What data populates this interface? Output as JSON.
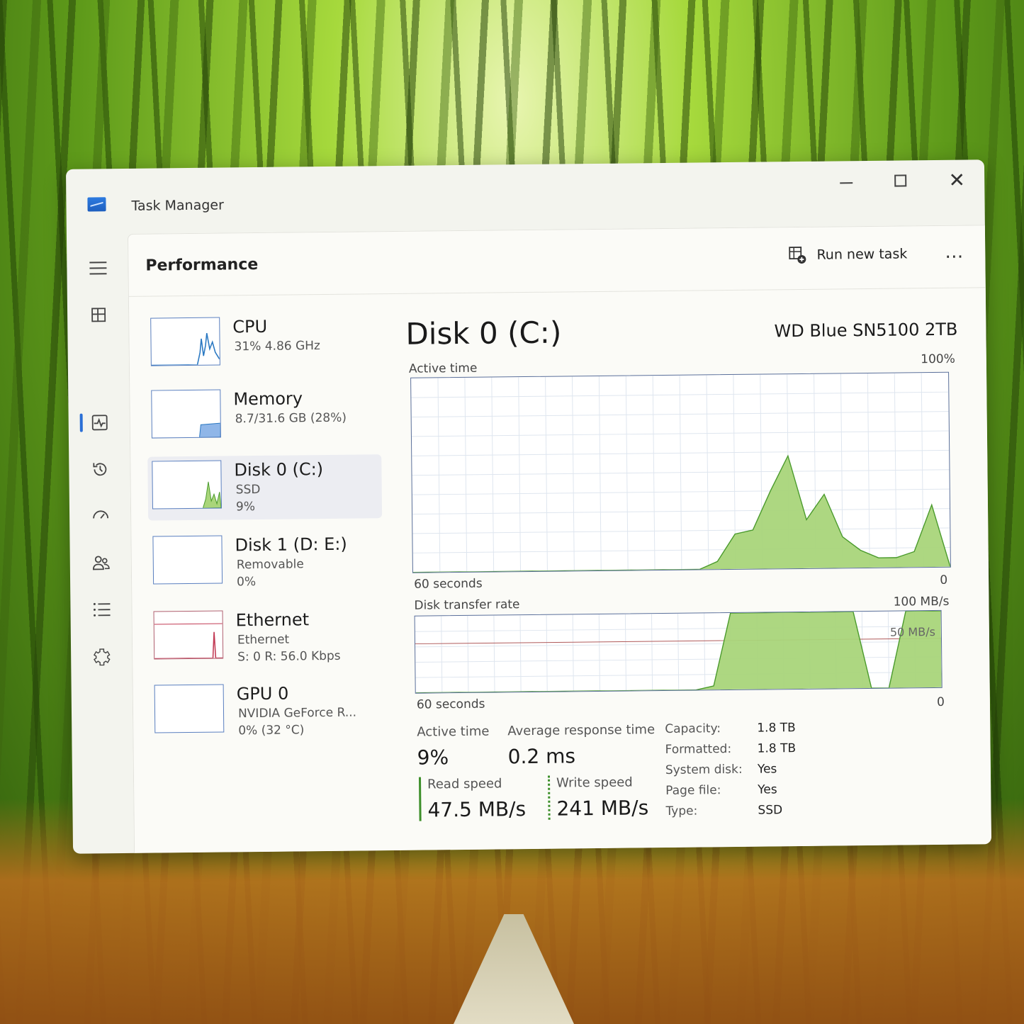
{
  "window": {
    "app_title": "Task Manager",
    "app_icon": "task-manager-icon"
  },
  "header": {
    "title": "Performance",
    "run_new_task": "Run new task",
    "more": "…"
  },
  "nav": {
    "items": [
      "menu-icon",
      "processes-icon",
      "performance-icon",
      "app-history-icon",
      "startup-apps-icon",
      "users-icon",
      "details-icon",
      "services-icon",
      "settings-icon"
    ],
    "selected": "performance-icon"
  },
  "devices": [
    {
      "name": "CPU",
      "sub1": "31% 4.86 GHz",
      "sub2": ""
    },
    {
      "name": "Memory",
      "sub1": "8.7/31.6 GB (28%)",
      "sub2": ""
    },
    {
      "name": "Disk 0 (C:)",
      "sub1": "SSD",
      "sub2": "9%"
    },
    {
      "name": "Disk 1 (D: E:)",
      "sub1": "Removable",
      "sub2": "0%"
    },
    {
      "name": "Ethernet",
      "sub1": "Ethernet",
      "sub2": "S: 0 R: 56.0 Kbps"
    },
    {
      "name": "GPU 0",
      "sub1": "NVIDIA GeForce R...",
      "sub2": "0% (32 °C)"
    }
  ],
  "selected_device": "Disk 0 (C:)",
  "detail": {
    "title": "Disk 0 (C:)",
    "model": "WD Blue SN5100 2TB",
    "active_time_graph": {
      "label": "Active time",
      "max": "100%",
      "x_left": "60 seconds",
      "x_right": "0"
    },
    "transfer_graph": {
      "label": "Disk transfer rate",
      "max": "100 MB/s",
      "mid": "50 MB/s",
      "x_left": "60 seconds",
      "x_right": "0"
    },
    "stats": {
      "active_time_label": "Active time",
      "active_time_value": "9%",
      "avg_response_label": "Average response time",
      "avg_response_value": "0.2 ms",
      "read_label": "Read speed",
      "read_value": "47.5 MB/s",
      "write_label": "Write speed",
      "write_value": "241 MB/s"
    },
    "properties": [
      {
        "key": "Capacity:",
        "value": "1.8 TB"
      },
      {
        "key": "Formatted:",
        "value": "1.8 TB"
      },
      {
        "key": "System disk:",
        "value": "Yes"
      },
      {
        "key": "Page file:",
        "value": "Yes"
      },
      {
        "key": "Type:",
        "value": "SSD"
      }
    ]
  },
  "colors": {
    "disk_fill": "#a9d57a",
    "disk_line": "#4a9a2c",
    "cpu_line": "#2a78c2",
    "memory_fill": "#8fb6e8",
    "ethernet_line": "#c23a54",
    "grid": "#dfe6ef"
  },
  "chart_data": [
    {
      "type": "area",
      "title": "Active time",
      "ylabel": "",
      "ylim": [
        0,
        100
      ],
      "x": [
        60,
        50,
        45,
        40,
        35,
        30,
        28,
        26,
        24,
        22,
        20,
        18,
        16,
        14,
        12,
        10,
        8,
        6,
        4,
        2,
        0
      ],
      "series": [
        {
          "values": [
            0,
            0,
            0,
            0,
            0,
            0,
            0,
            4,
            18,
            20,
            40,
            58,
            25,
            38,
            16,
            9,
            5,
            5,
            8,
            32,
            0
          ]
        }
      ]
    },
    {
      "type": "area",
      "title": "Disk transfer rate",
      "ylabel": "",
      "ylim": [
        0,
        100
      ],
      "x": [
        60,
        50,
        40,
        30,
        28,
        26,
        24,
        22,
        20,
        18,
        16,
        14,
        12,
        10,
        8,
        6,
        4,
        2,
        0
      ],
      "series": [
        {
          "values": [
            0,
            0,
            0,
            0,
            0,
            5,
            100,
            100,
            100,
            100,
            100,
            100,
            100,
            100,
            0,
            0,
            100,
            100,
            100
          ]
        }
      ]
    }
  ]
}
